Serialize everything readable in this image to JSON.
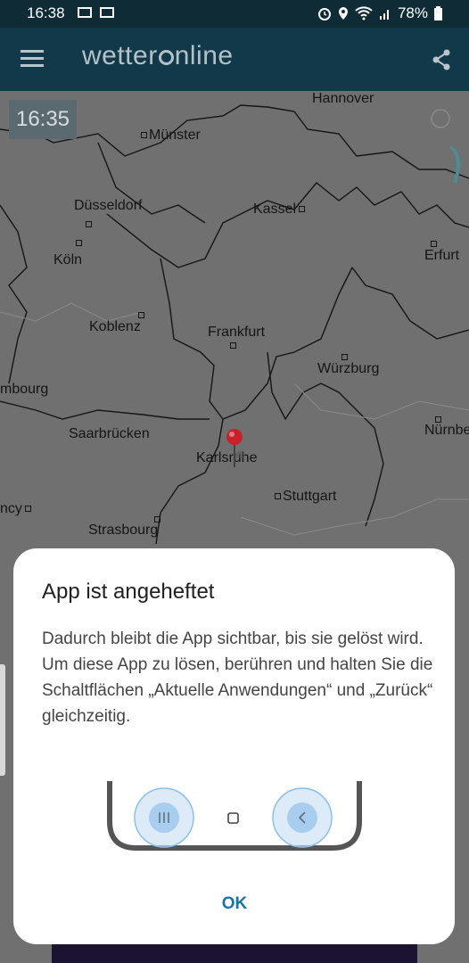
{
  "status_bar": {
    "time": "16:38",
    "battery": "78%"
  },
  "app_bar": {
    "logo_text_start": "wetter",
    "logo_text_end": "nline",
    "menu_icon": "hamburger-menu-icon",
    "share_icon": "share-icon"
  },
  "map": {
    "timestamp": "16:35",
    "cities": [
      {
        "name": "Hannover",
        "dot": false
      },
      {
        "name": "Münster",
        "dot": true
      },
      {
        "name": "Düsseldorf",
        "dot": true
      },
      {
        "name": "Kassel",
        "dot": true
      },
      {
        "name": "Köln",
        "dot": true
      },
      {
        "name": "Erfurt",
        "dot": true
      },
      {
        "name": "Koblenz",
        "dot": true
      },
      {
        "name": "Frankfurt",
        "dot": true
      },
      {
        "name": "Würzburg",
        "dot": true
      },
      {
        "name": "mbourg",
        "dot": false
      },
      {
        "name": "Saarbrücken",
        "dot": true
      },
      {
        "name": "Nürnbe",
        "dot": true
      },
      {
        "name": "Karlsruhe",
        "dot": true
      },
      {
        "name": "Stuttgart",
        "dot": true
      },
      {
        "name": "ncy",
        "dot": true
      },
      {
        "name": "Strasbourg",
        "dot": true
      }
    ]
  },
  "dialog": {
    "title": "App ist angeheftet",
    "line1": "Dadurch bleibt die App sichtbar, bis sie gelöst wird.",
    "line2": "Um diese App zu lösen, berühren und halten Sie die Schaltflächen „Aktuelle Anwendungen“ und „Zurück“ gleichzeitig.",
    "ok_label": "OK",
    "illustration_icons": [
      "recent-apps-icon",
      "home-icon",
      "back-icon"
    ]
  },
  "colors": {
    "app_bar": "#12394a",
    "status_bar": "#0e2b36",
    "accent": "#1675a8",
    "pin": "#c9202a"
  }
}
